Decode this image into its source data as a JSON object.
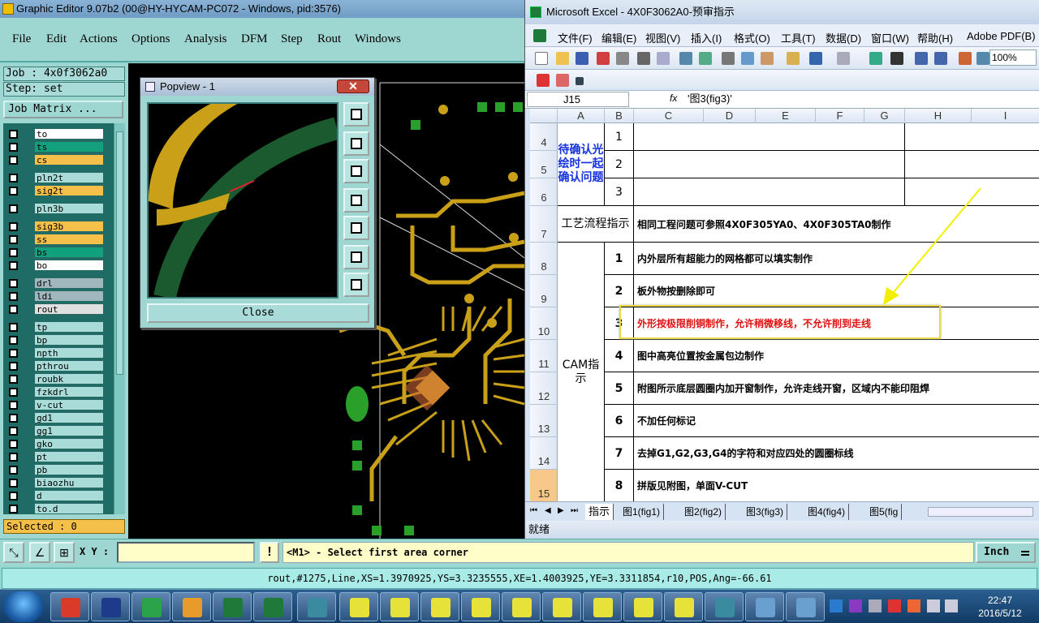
{
  "graphic_editor": {
    "window_title": "Graphic Editor 9.07b2 (00@HY-HYCAM-PC072 - Windows, pid:3576)",
    "menu": [
      "File",
      "Edit",
      "Actions",
      "Options",
      "Analysis",
      "DFM",
      "Step",
      "Rout",
      "Windows"
    ],
    "job_label": "Job : 4x0f3062a0",
    "step_label": "Step: set",
    "job_matrix_button": "Job Matrix ...",
    "layers": [
      {
        "name": "to",
        "color": "#ffffff"
      },
      {
        "name": "ts",
        "color": "#13a07c"
      },
      {
        "name": "cs",
        "color": "#f5c04a"
      },
      {
        "name": "pln2t",
        "color": "#a9dcd8"
      },
      {
        "name": "sig2t",
        "color": "#f5c04a"
      },
      {
        "name": "pln3b",
        "color": "#a9dcd8"
      },
      {
        "name": "sig3b",
        "color": "#f5c04a"
      },
      {
        "name": "ss",
        "color": "#f5c04a"
      },
      {
        "name": "bs",
        "color": "#13a07c"
      },
      {
        "name": "bo",
        "color": "#ffffff"
      },
      {
        "name": "drl",
        "color": "#9fb7bd"
      },
      {
        "name": "ldi",
        "color": "#9fb7bd"
      },
      {
        "name": "rout",
        "color": "#e0e0e0"
      },
      {
        "name": "tp",
        "color": "#a9dcd8"
      },
      {
        "name": "bp",
        "color": "#a9dcd8"
      },
      {
        "name": "npth",
        "color": "#a9dcd8"
      },
      {
        "name": "pthrou",
        "color": "#a9dcd8"
      },
      {
        "name": "roubk",
        "color": "#a9dcd8"
      },
      {
        "name": "fzkdrl",
        "color": "#a9dcd8"
      },
      {
        "name": "v-cut",
        "color": "#a9dcd8"
      },
      {
        "name": "gd1",
        "color": "#a9dcd8"
      },
      {
        "name": "gg1",
        "color": "#a9dcd8"
      },
      {
        "name": "gko",
        "color": "#a9dcd8"
      },
      {
        "name": "pt",
        "color": "#a9dcd8"
      },
      {
        "name": "pb",
        "color": "#a9dcd8"
      },
      {
        "name": "biaozhu",
        "color": "#a9dcd8"
      },
      {
        "name": "d",
        "color": "#a9dcd8"
      },
      {
        "name": "to.d",
        "color": "#a9dcd8"
      }
    ],
    "selected_label": "Selected : 0",
    "xy_label": "X Y :",
    "xy_value": "",
    "prompt": "<M1> - Select first area corner",
    "units": "Inch",
    "status_line": "rout,#1275,Line,XS=1.3970925,YS=3.3235555,XE=1.4003925,YE=3.3311854,r10,POS,Ang=-66.61",
    "popview": {
      "title": "Popview - 1",
      "close_x": "✕",
      "close_button": "Close"
    }
  },
  "excel": {
    "window_title": "Microsoft Excel - 4X0F3062A0-预审指示",
    "menu": [
      "文件(F)",
      "编辑(E)",
      "视图(V)",
      "插入(I)",
      "格式(O)",
      "工具(T)",
      "数据(D)",
      "窗口(W)",
      "帮助(H)",
      "Adobe PDF(B)"
    ],
    "zoom": "100%",
    "name_box": "J15",
    "fx": "fx",
    "formula": "'图3(fig3)'",
    "columns": [
      "A",
      "B",
      "C",
      "D",
      "E",
      "F",
      "G",
      "H",
      "I"
    ],
    "rows": [
      "4",
      "5",
      "6",
      "7",
      "8",
      "9",
      "10",
      "11",
      "12",
      "13",
      "14",
      "15"
    ],
    "merged_a_4_6": "待确认光绘时一起确认问题",
    "b_4_6": [
      "1",
      "2",
      "3"
    ],
    "a_7": "工艺流程指示",
    "c_7": "相同工程问题可参照4X0F305YA0、4X0F305TA0制作",
    "a_8_15": "CAM指示",
    "instructions": [
      {
        "no": "1",
        "text": "内外层所有超能力的网格都可以填实制作"
      },
      {
        "no": "2",
        "text": "板外物按删除即可"
      },
      {
        "no": "3",
        "text": "外形按极限削铜制作，允许稍微移线，不允许削到走线",
        "highlight": true
      },
      {
        "no": "4",
        "text": "图中高亮位置按金属包边制作"
      },
      {
        "no": "5",
        "text": "附图所示底层圆圈内加开窗制作，允许走线开窗，区域内不能印阻焊"
      },
      {
        "no": "6",
        "text": "不加任何标记"
      },
      {
        "no": "7",
        "text": "去掉G1,G2,G3,G4的字符和对应四处的圆圈标线"
      },
      {
        "no": "8",
        "text": "拼版见附图，单面V-CUT"
      }
    ],
    "sheet_tabs": [
      "指示",
      "图1(fig1)",
      "图2(fig2)",
      "图3(fig3)",
      "图4(fig4)",
      "图5(fig"
    ],
    "status": "就绪"
  },
  "taskbar": {
    "time": "22:47",
    "date": "2016/5/12"
  }
}
